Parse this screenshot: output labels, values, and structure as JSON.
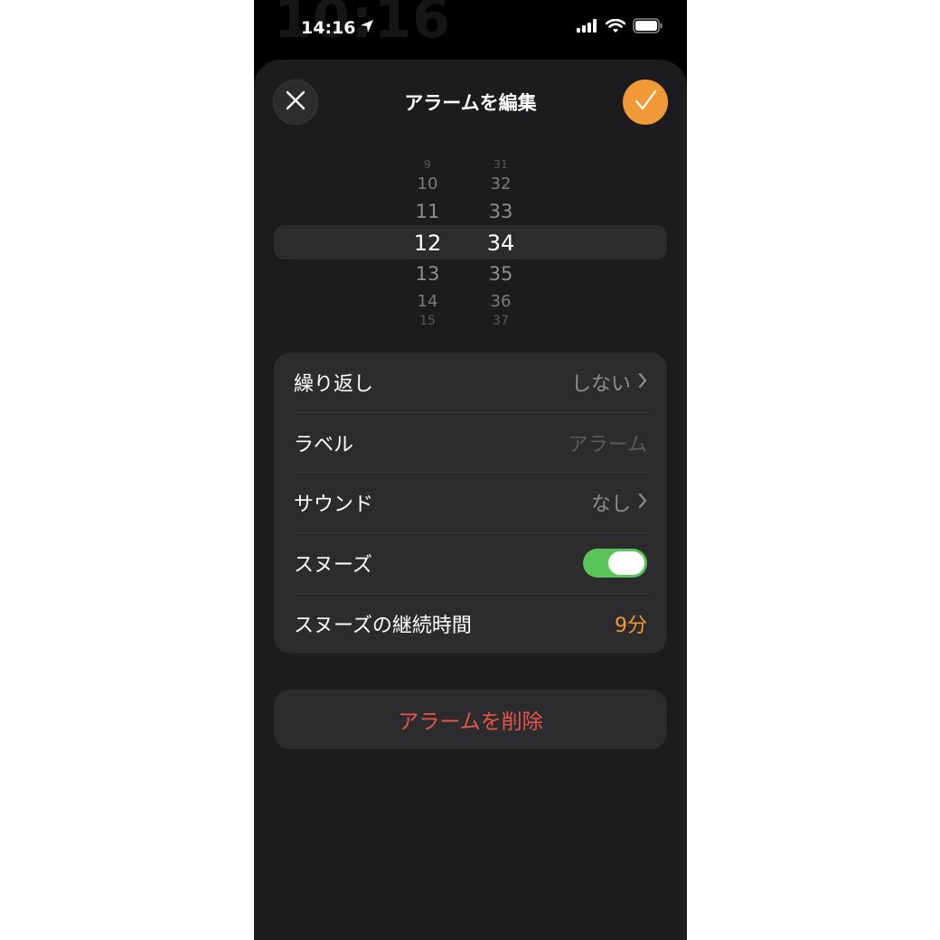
{
  "status_bar": {
    "time": "14:16",
    "ghost_time": "10:16",
    "location_icon": "location-arrow-icon",
    "signal_icon": "cellular-signal-icon",
    "wifi_icon": "wifi-icon",
    "battery_icon": "battery-icon"
  },
  "header": {
    "title": "アラームを編集",
    "close_icon": "close-icon",
    "done_icon": "checkmark-icon",
    "accent_color": "#f09a37"
  },
  "picker": {
    "hours": [
      "9",
      "10",
      "11",
      "12",
      "13",
      "14",
      "15"
    ],
    "minutes": [
      "31",
      "32",
      "33",
      "34",
      "35",
      "36",
      "37"
    ],
    "selected_hour": "12",
    "selected_minute": "34"
  },
  "settings": {
    "repeat": {
      "label": "繰り返し",
      "value": "しない"
    },
    "label": {
      "label": "ラベル",
      "placeholder": "アラーム"
    },
    "sound": {
      "label": "サウンド",
      "value": "なし"
    },
    "snooze": {
      "label": "スヌーズ",
      "enabled": true,
      "toggle_color": "#5ac35a"
    },
    "snooze_duration": {
      "label": "スヌーズの継続時間",
      "value": "9分"
    }
  },
  "delete_button": {
    "label": "アラームを削除",
    "color": "#e8544b"
  }
}
